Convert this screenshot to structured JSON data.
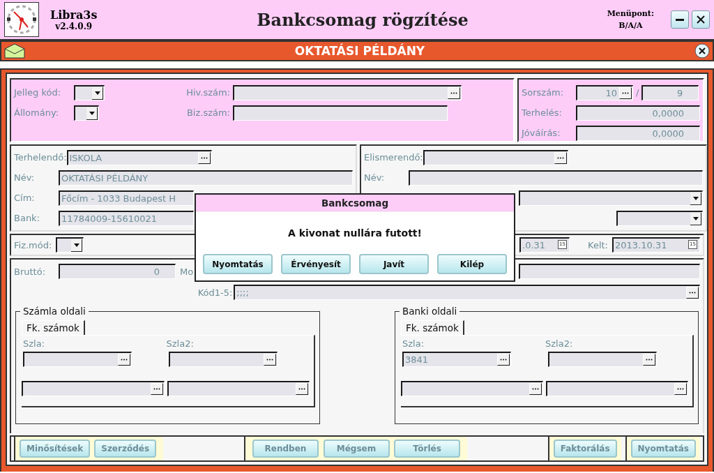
{
  "app": {
    "name": "Libra3s",
    "version": "v2.4.0.9"
  },
  "window": {
    "title": "Bankcsomag rögzítése",
    "menu_label": "Menüpont:",
    "menu_code": "B/A/A"
  },
  "banner": {
    "title": "OKTATÁSI PÉLDÁNY"
  },
  "header": {
    "jelleg_label": "Jelleg kód:",
    "allomany_label": "Állomány:",
    "hiv_label": "Hiv.szám:",
    "biz_label": "Biz.szám:"
  },
  "totals": {
    "sorszam_label": "Sorszám:",
    "sorszam": "10",
    "separator": "/",
    "sorszam_total": "9",
    "terheles_label": "Terhelés:",
    "terheles": "0,0000",
    "jovairas_label": "Jóváírás:",
    "jovairas": "0,0000"
  },
  "debit": {
    "label": "Terhelendő:",
    "value": "ISKOLA",
    "name_label": "Név:",
    "name": "OKTATÁSI PÉLDÁNY",
    "address_label": "Cím:",
    "address": "Főcím - 1033 Budapest H",
    "bank_label": "Bank:",
    "bank": "11784009-15610021"
  },
  "credit": {
    "label": "Elismerendő:",
    "name_label": "Név:"
  },
  "payment": {
    "label": "Fiz.mód:",
    "date_partial": ".0.31",
    "date_icon": "15",
    "kelt_label": "Kelt:",
    "kelt": "2013.10.31",
    "kelt_icon": "15"
  },
  "amounts": {
    "brutto_label": "Bruttó:",
    "brutto": "0",
    "memo_label_partial": "Mo",
    "codes_label": "Kód1-5:",
    "codes": ";;;;"
  },
  "groups": [
    {
      "title": "Számla oldali",
      "tab": "Fk. számok",
      "szla_label": "Szla:",
      "szla2_label": "Szla2:"
    },
    {
      "title": "Banki oldali",
      "tab": "Fk. számok",
      "szla_label": "Szla:",
      "szla": "3841",
      "szla2_label": "Szla2:"
    }
  ],
  "bottom_buttons": [
    {
      "label": "Minősítések",
      "disabled": true
    },
    {
      "label": "Szerződés",
      "disabled": true
    },
    {
      "label": "Rendben",
      "disabled": true
    },
    {
      "label": "Mégsem",
      "disabled": true
    },
    {
      "label": "Törlés",
      "disabled": true
    },
    {
      "label": "Faktorálás",
      "disabled": true
    },
    {
      "label": "Nyomtatás",
      "disabled": true
    }
  ],
  "dialog": {
    "title": "Bankcsomag",
    "message": "A kivonat nullára futott!",
    "buttons": [
      {
        "label": "Nyomtatás",
        "disabled": false
      },
      {
        "label": "Érvényesít",
        "disabled": false
      },
      {
        "label": "Javít",
        "disabled": false
      },
      {
        "label": "Kilép",
        "disabled": false
      }
    ]
  }
}
